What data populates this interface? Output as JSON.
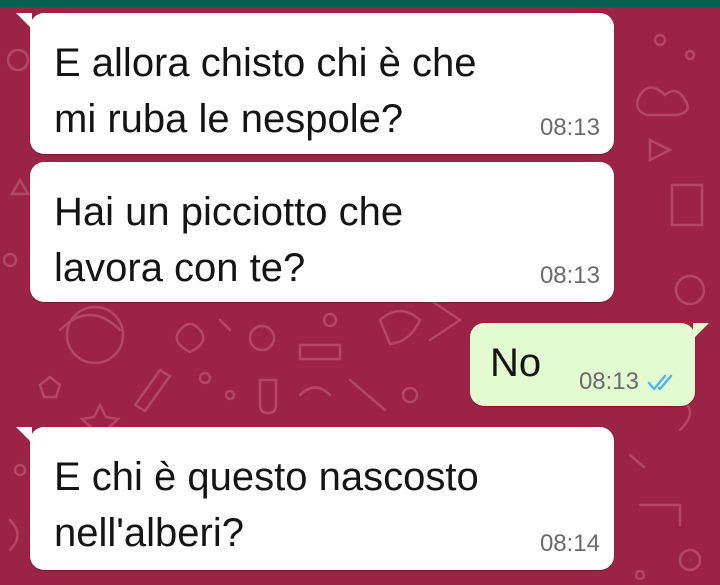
{
  "colors": {
    "wallpaper": "#9b2345",
    "incoming_bubble": "#ffffff",
    "outgoing_bubble": "#e2fbd0",
    "read_ticks": "#4fb6ec",
    "header": "#0d5c4f"
  },
  "messages": [
    {
      "direction": "incoming",
      "text": "E allora chisto chi è che\nmi ruba le nespole?",
      "time": "08:13"
    },
    {
      "direction": "incoming",
      "text": "Hai un picciotto che\nlavora con te?",
      "time": "08:13"
    },
    {
      "direction": "outgoing",
      "text": "No",
      "time": "08:13",
      "status_icon": "double-check-read-icon"
    },
    {
      "direction": "incoming",
      "text": "E chi è questo nascosto\nnell'alberi?",
      "time": "08:14"
    }
  ]
}
